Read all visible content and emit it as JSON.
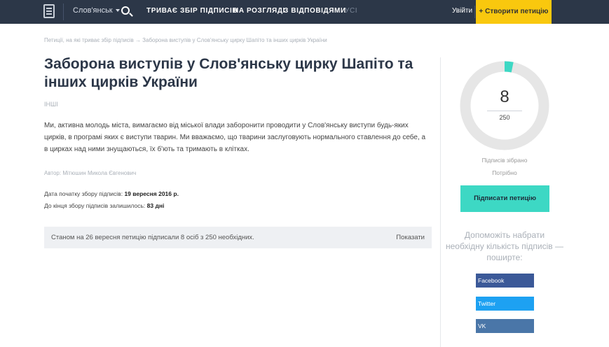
{
  "header": {
    "city": "Слов'янськ",
    "nav": [
      "ТРИВАЄ ЗБІР ПІДПИСІВ",
      "НА РОЗГЛЯДІ",
      "З ВІДПОВІДЯМИ",
      "УСІ"
    ],
    "login": "Увійти",
    "create": "+ Створити петицію"
  },
  "breadcrumb": "Петиції, на які триває збір підписів → Заборона виступів у Слов'янську цирку Шапіто та інших цирків України",
  "petition": {
    "title": "Заборона виступів у Слов'янську цирку Шапіто та інших цирків України",
    "category": "ІНШІ",
    "description": "Ми, активна молодь міста, вимагаємо від міської влади заборонити проводити у Слов'янську виступи будь-яких цирків, в програмі яких є виступи тварин. Ми вважаємо, що тварини заслуговують нормального ставлення до себе, а в цирках над ними знущаються, їх б'ють та тримають в клітках.",
    "author": "Автор: Мітюшин Микола Євгенович",
    "start_label": "Дата початку збору підписів:",
    "start_value": "19 вересня 2016 р.",
    "remain_label": "До кінця збору підписів залишилось:",
    "remain_value": "83 дні",
    "status": "Станом на 26 вересня петицію підписали 8 осіб з 250 необхідних.",
    "show": "Показати"
  },
  "sidebar": {
    "signed": "8",
    "needed_total": "250",
    "progress_fraction": 0.032,
    "collected_label": "Підписів зібрано",
    "needed_label": "Потрібно",
    "sign_button": "Підписати петицію",
    "help_text": "Допоможіть набрати необхідну кількість підписів — поширте:",
    "share": [
      "Facebook",
      "Twitter",
      "VK"
    ],
    "colors": {
      "progress": "#3dd8c4",
      "track": "#e6e6e6"
    }
  }
}
